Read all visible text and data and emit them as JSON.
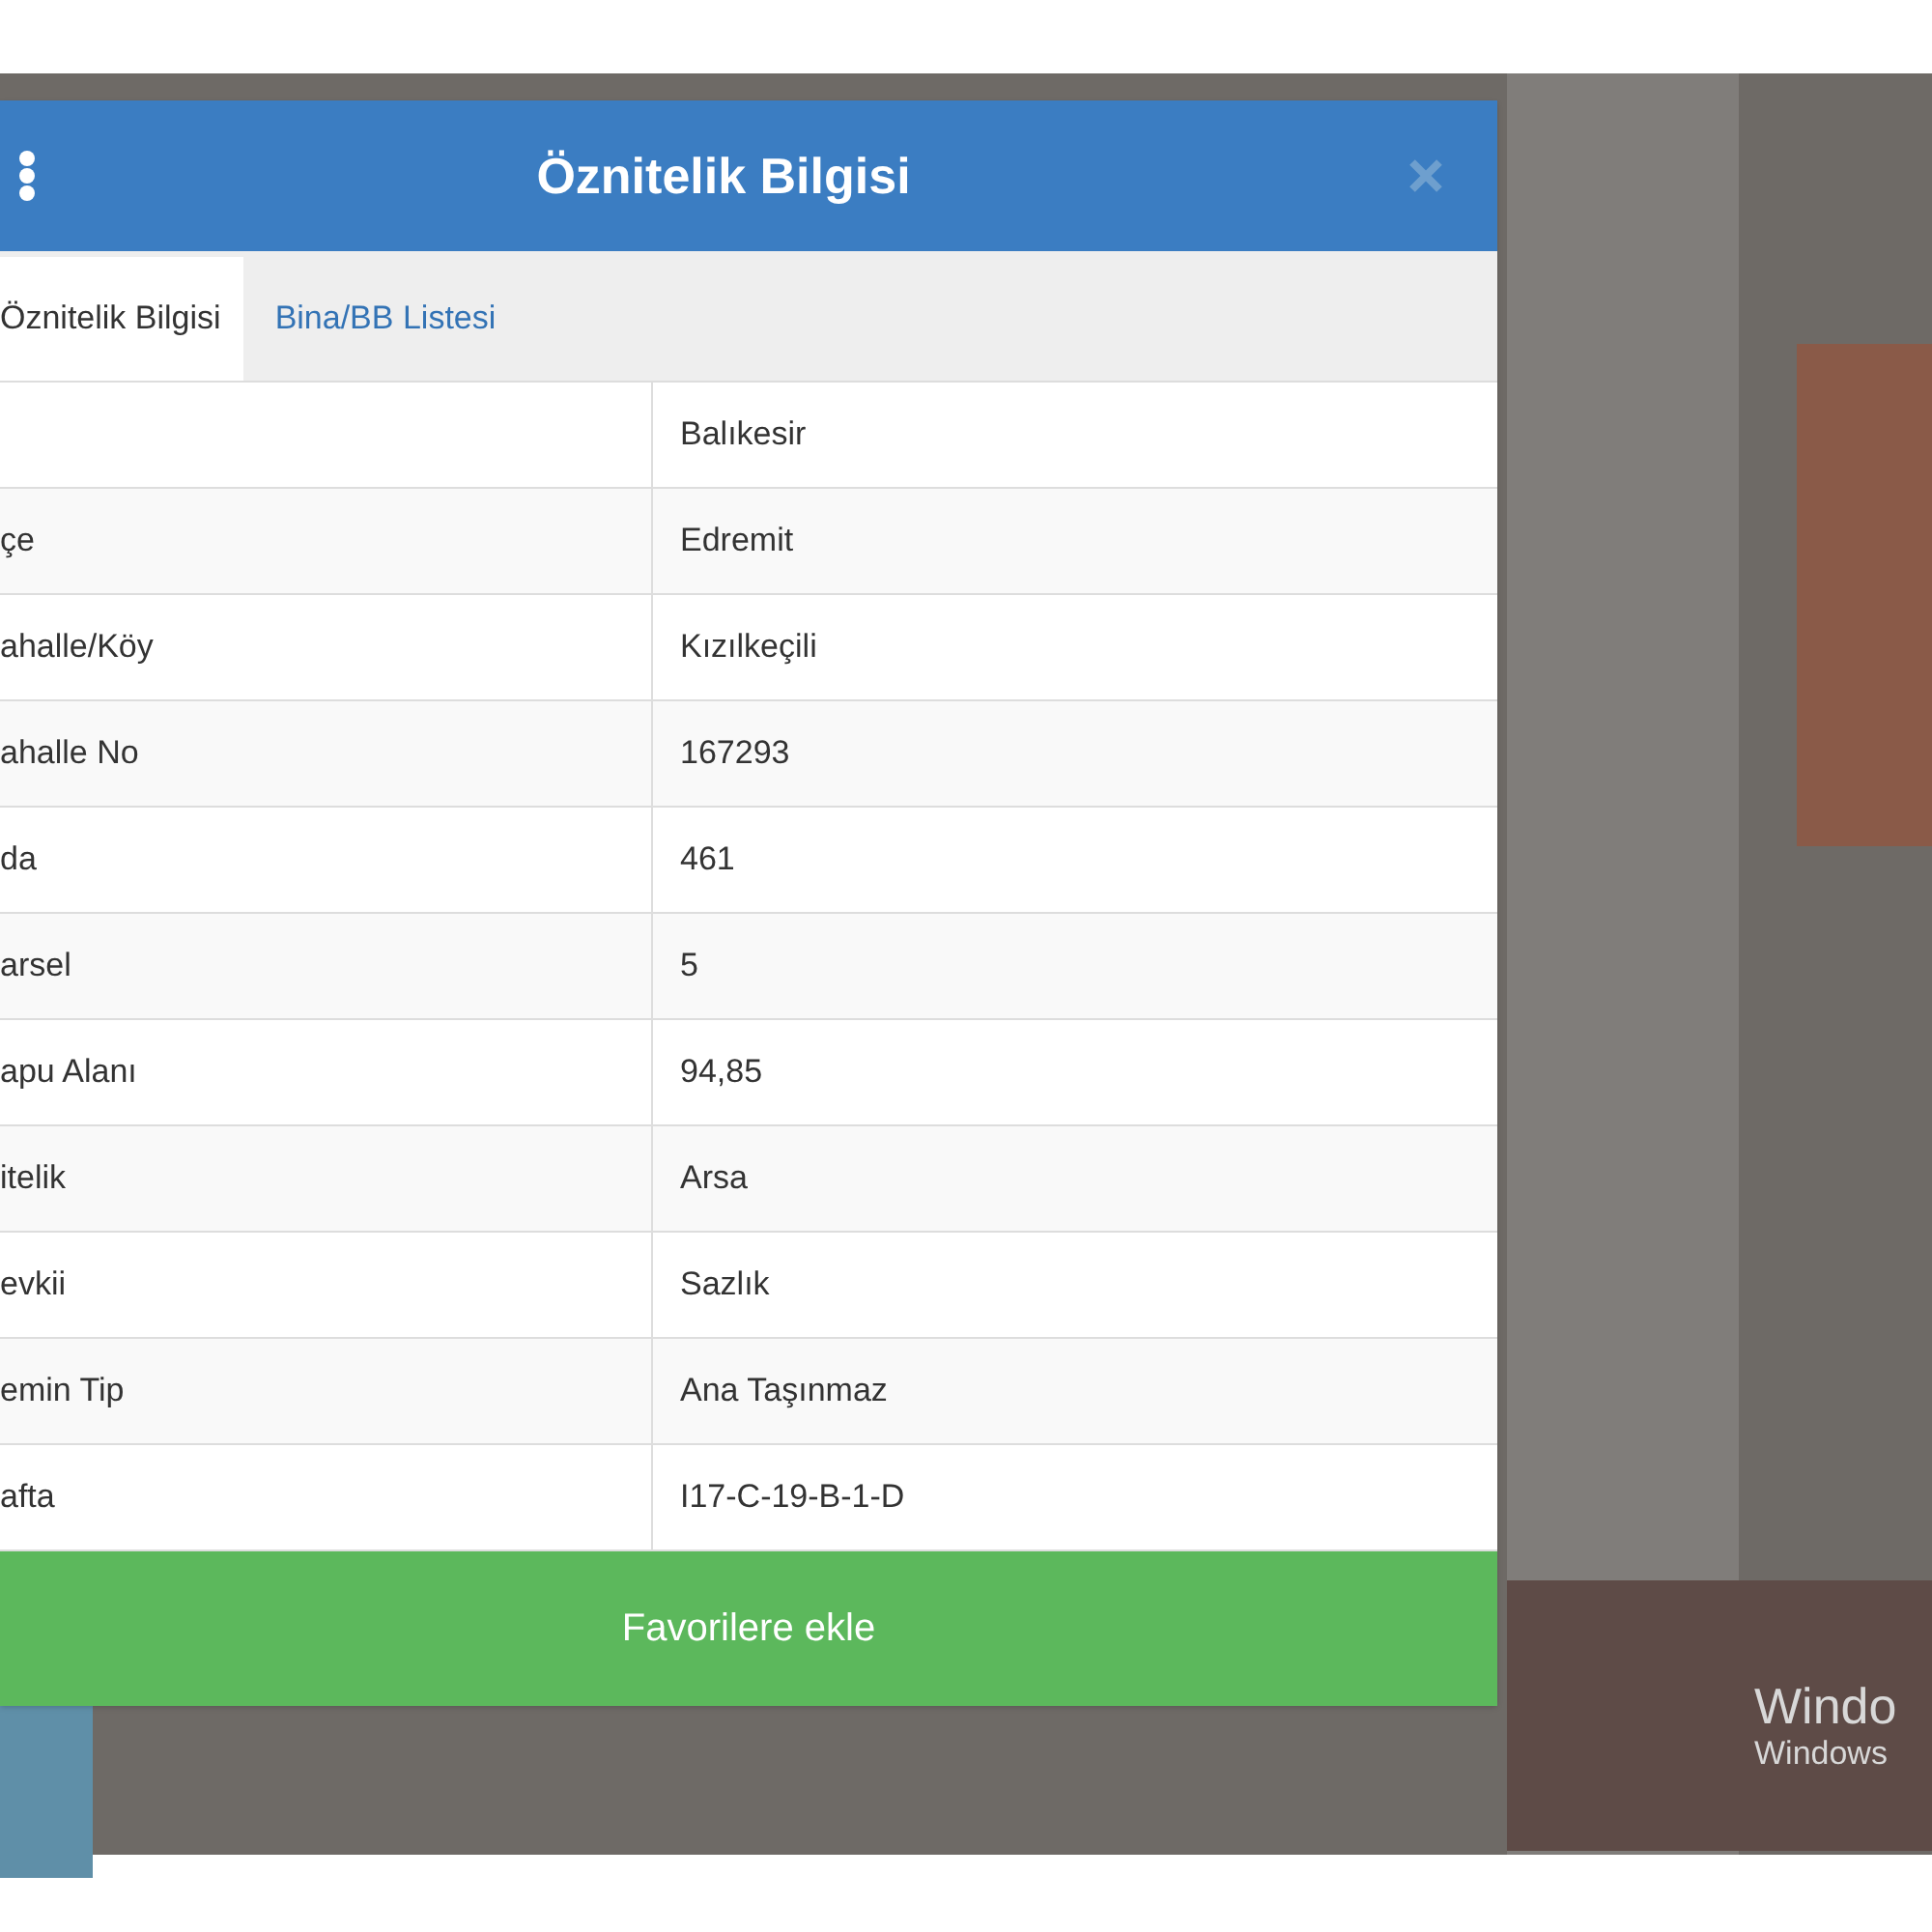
{
  "dialog": {
    "title": "Öznitelik Bilgisi",
    "tabs": [
      {
        "label": "Öznitelik Bilgisi",
        "selected": true
      },
      {
        "label": "Bina/BB Listesi",
        "selected": false
      }
    ],
    "rows": [
      {
        "value": "Balıkesir"
      },
      {
        "label": "çe",
        "value": "Edremit"
      },
      {
        "label": "ahalle/Köy",
        "value": "Kızılkeçili"
      },
      {
        "label": "ahalle No",
        "value": "167293"
      },
      {
        "label": "da",
        "value": "461"
      },
      {
        "label": "arsel",
        "value": "5"
      },
      {
        "label": "apu Alanı",
        "value": "94,85"
      },
      {
        "label": "itelik",
        "value": "Arsa"
      },
      {
        "label": "evkii",
        "value": "Sazlık"
      },
      {
        "label": "emin Tip",
        "value": "Ana Taşınmaz"
      },
      {
        "label": "afta",
        "value": "I17-C-19-B-1-D"
      }
    ],
    "button": "Favorilere ekle"
  },
  "map": {
    "overlay_lines": [
      "Windo",
      "Windows"
    ]
  }
}
